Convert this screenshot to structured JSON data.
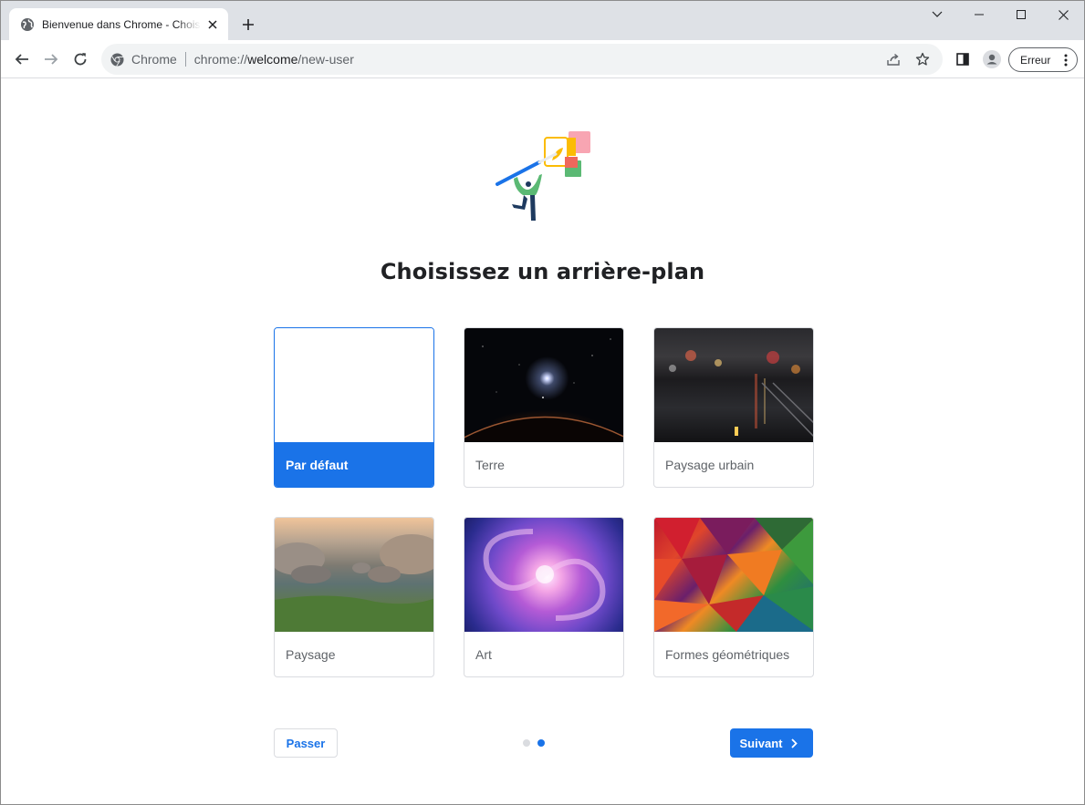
{
  "browser": {
    "tab": {
      "title": "Bienvenue dans Chrome - Choisissez un arrière-plan"
    },
    "omnibox": {
      "site_label": "Chrome",
      "url_prefix": "chrome://",
      "url_host": "welcome",
      "url_path": "/new-user"
    },
    "profile_error_label": "Erreur"
  },
  "page": {
    "heading": "Choisissez un arrière-plan",
    "backgrounds": [
      {
        "label": "Par défaut",
        "thumb": "default",
        "selected": true
      },
      {
        "label": "Terre",
        "thumb": "earth",
        "selected": false
      },
      {
        "label": "Paysage urbain",
        "thumb": "city",
        "selected": false
      },
      {
        "label": "Paysage",
        "thumb": "landscape",
        "selected": false
      },
      {
        "label": "Art",
        "thumb": "art",
        "selected": false
      },
      {
        "label": "Formes géométriques",
        "thumb": "geometric",
        "selected": false
      }
    ],
    "skip_label": "Passer",
    "next_label": "Suivant",
    "step_total": 2,
    "step_current": 2
  },
  "colors": {
    "accent": "#1a73e8",
    "tabstrip_bg": "#dee1e6",
    "omnibox_bg": "#f1f3f4"
  },
  "icons": [
    "globe-icon",
    "close-icon",
    "plus-icon",
    "chevron-down-icon",
    "minimize-icon",
    "maximize-icon",
    "back-arrow-icon",
    "forward-arrow-icon",
    "reload-icon",
    "chrome-logo-icon",
    "share-icon",
    "star-icon",
    "side-panel-icon",
    "profile-avatar-icon",
    "kebab-menu-icon",
    "chevron-right-icon"
  ]
}
